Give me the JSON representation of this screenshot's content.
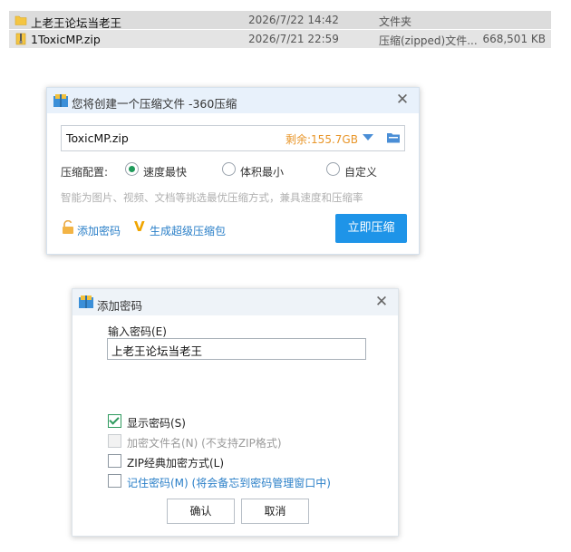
{
  "files": [
    {
      "name": "上老王论坛当老王",
      "date": "2026/7/22 14:42",
      "type": "文件夹",
      "size": "",
      "icon": "folder-icon"
    },
    {
      "name": "1ToxicMP.zip",
      "date": "2026/7/21 22:59",
      "type": "压缩(zipped)文件...",
      "size": "668,501 KB",
      "icon": "zip-icon"
    }
  ],
  "compress_dialog": {
    "title": "您将创建一个压缩文件 -360压缩",
    "filename": "ToxicMP.zip",
    "remaining": "剩余:155.7GB",
    "config_label": "压缩配置:",
    "options": [
      "速度最快",
      "体积最小",
      "自定义"
    ],
    "selected_option": "速度最快",
    "hint": "智能为图片、视频、文档等挑选最优压缩方式，兼具速度和压缩率",
    "add_password": "添加密码",
    "super_package": "生成超级压缩包",
    "compress_button": "立即压缩"
  },
  "password_dialog": {
    "title": "添加密码",
    "input_label": "输入密码(E)",
    "password_value": "上老王论坛当老王",
    "checkboxes": [
      {
        "label": "显示密码(S)",
        "checked": true,
        "disabled": false
      },
      {
        "label": "加密文件名(N) (不支持ZIP格式)",
        "checked": false,
        "disabled": true
      },
      {
        "label": "ZIP经典加密方式(L)",
        "checked": false,
        "disabled": false
      },
      {
        "label": "记住密码(M) (将会备忘到密码管理窗口中)",
        "checked": false,
        "disabled": false
      }
    ],
    "ok_button": "确认",
    "cancel_button": "取消"
  },
  "colors": {
    "accent": "#1e94e8",
    "link": "#2a7fc8",
    "remaining": "#e8962a",
    "radio_selected": "#1f9a5a"
  }
}
